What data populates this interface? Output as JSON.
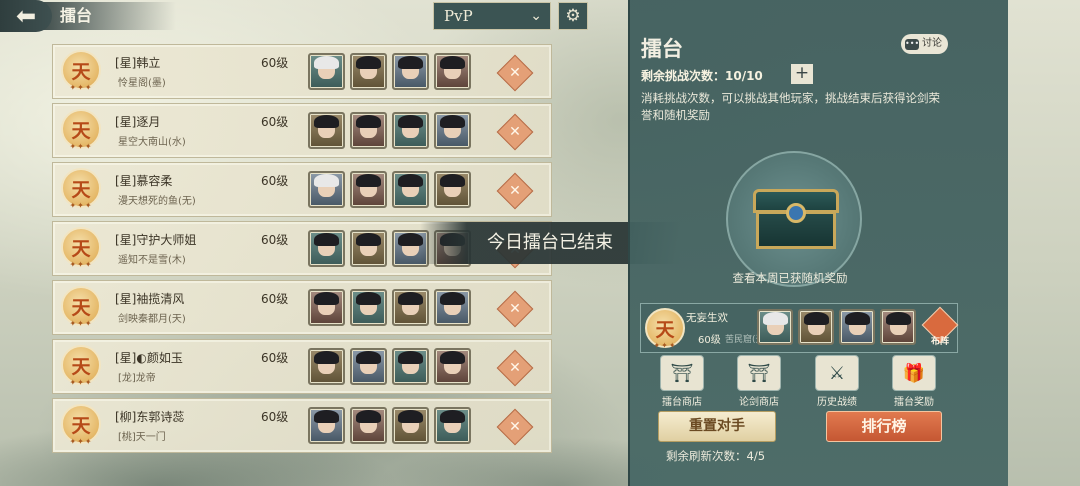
{
  "header": {
    "title": "擂台",
    "mode_select": "PvP"
  },
  "rank_badge_char": "天",
  "rank_badge_stars": "✦✦✦",
  "opponents": [
    {
      "name": "[星]韩立",
      "guild": "怜星阁(墨)",
      "level": "60级"
    },
    {
      "name": "[星]逐月",
      "guild": "星空大南山(水)",
      "level": "60级"
    },
    {
      "name": "[星]慕容柔",
      "guild": "漫天想死的鱼(无)",
      "level": "60级"
    },
    {
      "name": "[星]守护大师姐",
      "guild": "遥知不是雪(木)",
      "level": "60级"
    },
    {
      "name": "[星]袖揽清风",
      "guild": "剑映秦都月(天)",
      "level": "60级"
    },
    {
      "name": "[星]◐颜如玉",
      "guild": "[龙]龙帝",
      "level": "60级"
    },
    {
      "name": "[柳]东郭诗蕊",
      "guild": "[桃]天一门",
      "level": "60级"
    }
  ],
  "toast": "今日擂台已结束",
  "panel": {
    "title": "擂台",
    "discuss_label": "讨论",
    "challenges_label": "剩余挑战次数：10/10",
    "description": "消耗挑战次数，可以挑战其他玩家，挑战结束后获得论剑荣誉和随机奖励",
    "chest_caption": "查看本周已获随机奖励",
    "self": {
      "name": "无妄生欢",
      "level": "60级",
      "guild": "苦民窟(天)"
    },
    "formation_label": "布阵",
    "shops": [
      {
        "label": "擂台商店",
        "icon": "shop-icon"
      },
      {
        "label": "论剑商店",
        "icon": "sword-shop-icon"
      },
      {
        "label": "历史战绩",
        "icon": "crossed-swords-icon"
      },
      {
        "label": "擂台奖励",
        "icon": "reward-chest-icon"
      }
    ],
    "reset_button": "重置对手",
    "rank_button": "排行榜",
    "refresh_label": "剩余刷新次数：4/5"
  },
  "colors": {
    "panel_bg": "#3f5d5c",
    "accent_orange": "#d96a3e",
    "fight_button": "#e4a077"
  }
}
